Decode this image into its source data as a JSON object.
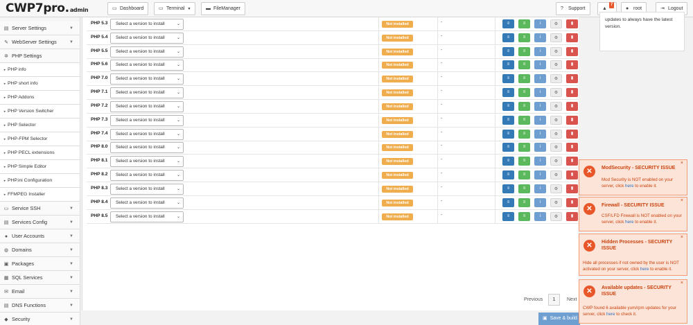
{
  "header": {
    "logo": "CWP7pro.",
    "logo_suffix": "admin",
    "nav": [
      {
        "label": "Dashboard",
        "icon": "monitor-icon"
      },
      {
        "label": "Terminal",
        "icon": "terminal-icon"
      },
      {
        "label": "FileManager",
        "icon": "folder-icon"
      }
    ],
    "support_label": "Support",
    "notifications_count": "7",
    "user_label": "root",
    "logout_label": "Logout"
  },
  "sidebar": {
    "items": [
      {
        "label": "Server Settings",
        "icon": "server-icon",
        "type": "main"
      },
      {
        "label": "WebServer Settings",
        "icon": "pencil-icon",
        "type": "main"
      },
      {
        "label": "PHP Settings",
        "icon": "gear-icon",
        "type": "main"
      },
      {
        "label": "PHP info",
        "type": "sub"
      },
      {
        "label": "PHP short info",
        "type": "sub"
      },
      {
        "label": "PHP Addons",
        "type": "sub"
      },
      {
        "label": "PHP Version Switcher",
        "type": "sub"
      },
      {
        "label": "PHP Selector",
        "type": "sub"
      },
      {
        "label": "PHP-FPM Selector",
        "type": "sub"
      },
      {
        "label": "PHP PECL extensions",
        "type": "sub"
      },
      {
        "label": "PHP Simple Editor",
        "type": "sub"
      },
      {
        "label": "PHP.ini Configuration",
        "type": "sub"
      },
      {
        "label": "FFMPEG Installer",
        "type": "sub"
      },
      {
        "label": "Service SSH",
        "icon": "terminal-icon",
        "type": "main"
      },
      {
        "label": "Services Config",
        "icon": "server-icon",
        "type": "main"
      },
      {
        "label": "User Accounts",
        "icon": "user-icon",
        "type": "main"
      },
      {
        "label": "Domains",
        "icon": "globe-icon",
        "type": "main"
      },
      {
        "label": "Packages",
        "icon": "box-icon",
        "type": "main"
      },
      {
        "label": "SQL Services",
        "icon": "database-icon",
        "type": "main"
      },
      {
        "label": "Email",
        "icon": "envelope-icon",
        "type": "main"
      },
      {
        "label": "DNS Functions",
        "icon": "server-icon",
        "type": "main"
      },
      {
        "label": "Security",
        "icon": "shield-icon",
        "type": "main"
      }
    ]
  },
  "php_table": {
    "select_placeholder": "Select a version to install",
    "status_label": "Not installed",
    "dash": "-",
    "versions": [
      "PHP 5.3",
      "PHP 5.4",
      "PHP 5.5",
      "PHP 5.6",
      "PHP 7.0",
      "PHP 7.1",
      "PHP 7.2",
      "PHP 7.3",
      "PHP 7.4",
      "PHP 8.0",
      "PHP 8.1",
      "PHP 8.2",
      "PHP 8.3",
      "PHP 8.4",
      "PHP 8.5"
    ]
  },
  "pagination": {
    "previous": "Previous",
    "page": "1",
    "next": "Next"
  },
  "save_button": "Save & build",
  "info_box": {
    "line1": "updates to always have the latest",
    "line2": "version."
  },
  "notifications": [
    {
      "title": "ModSecurity - SECURITY ISSUE",
      "line1": "Mod Security is NOT enabled on your",
      "line2_pre": "server, click ",
      "link": "here",
      "line2_post": " to enable it."
    },
    {
      "title": "Firewall - SECURITY ISSUE",
      "line1": "CSF/LFD Firewall is NOT enabled on your",
      "line2_pre": "server, click ",
      "link": "here",
      "line2_post": " to enable it."
    },
    {
      "title_line1": "Hidden Processes - SECURITY",
      "title_line2": "ISSUE",
      "line1": "Hide all processes if not owned by the user is NOT",
      "line2_pre": "activated on your server, click ",
      "link": "here",
      "line2_post": " to enable it."
    },
    {
      "title_line1": "Available updates - SECURITY",
      "title_line2": "ISSUE",
      "line1": "CWP found 6 available yum/rpm updates for your",
      "line2_pre": "server, click ",
      "link": "here",
      "line2_post": " to check it."
    }
  ],
  "colors": {
    "status_orange": "#f0ad4e",
    "btn_blue": "#337ab7",
    "btn_green": "#5cb85c",
    "btn_red": "#d9534f",
    "notif_bg": "#fde4d8",
    "notif_accent": "#e8572a"
  }
}
